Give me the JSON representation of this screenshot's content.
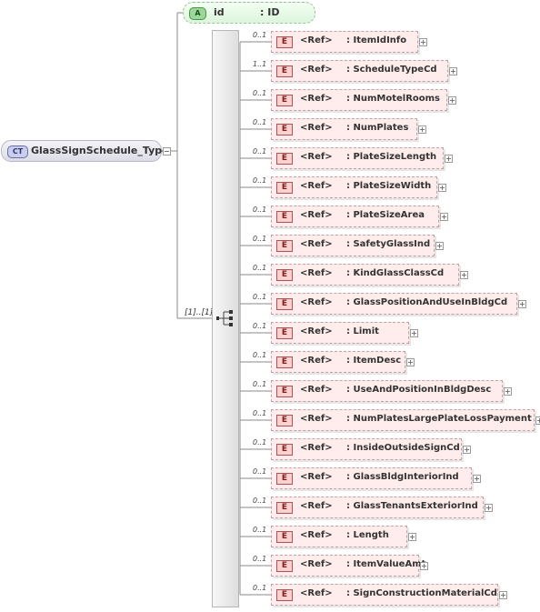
{
  "complex_type": {
    "badge": "CT",
    "name": "GlassSignSchedule_Type"
  },
  "attribute": {
    "badge": "A",
    "name": "id",
    "type": ": ID"
  },
  "sequence": {
    "cardinality": "[1]..[1]"
  },
  "elements": [
    {
      "card": "0..1",
      "badge": "E",
      "ref": "<Ref>",
      "name": ": ItemIdInfo"
    },
    {
      "card": "1..1",
      "badge": "E",
      "ref": "<Ref>",
      "name": ": ScheduleTypeCd"
    },
    {
      "card": "0..1",
      "badge": "E",
      "ref": "<Ref>",
      "name": ": NumMotelRooms"
    },
    {
      "card": "0..1",
      "badge": "E",
      "ref": "<Ref>",
      "name": ": NumPlates"
    },
    {
      "card": "0..1",
      "badge": "E",
      "ref": "<Ref>",
      "name": ": PlateSizeLength"
    },
    {
      "card": "0..1",
      "badge": "E",
      "ref": "<Ref>",
      "name": ": PlateSizeWidth"
    },
    {
      "card": "0..1",
      "badge": "E",
      "ref": "<Ref>",
      "name": ": PlateSizeArea"
    },
    {
      "card": "0..1",
      "badge": "E",
      "ref": "<Ref>",
      "name": ": SafetyGlassInd"
    },
    {
      "card": "0..1",
      "badge": "E",
      "ref": "<Ref>",
      "name": ": KindGlassClassCd"
    },
    {
      "card": "0..1",
      "badge": "E",
      "ref": "<Ref>",
      "name": ": GlassPositionAndUseInBldgCd"
    },
    {
      "card": "0..1",
      "badge": "E",
      "ref": "<Ref>",
      "name": ": Limit"
    },
    {
      "card": "0..1",
      "badge": "E",
      "ref": "<Ref>",
      "name": ": ItemDesc"
    },
    {
      "card": "0..1",
      "badge": "E",
      "ref": "<Ref>",
      "name": ": UseAndPositionInBldgDesc"
    },
    {
      "card": "0..1",
      "badge": "E",
      "ref": "<Ref>",
      "name": ": NumPlatesLargePlateLossPayment"
    },
    {
      "card": "0..1",
      "badge": "E",
      "ref": "<Ref>",
      "name": ": InsideOutsideSignCd"
    },
    {
      "card": "0..1",
      "badge": "E",
      "ref": "<Ref>",
      "name": ": GlassBldgInteriorInd"
    },
    {
      "card": "0..1",
      "badge": "E",
      "ref": "<Ref>",
      "name": ": GlassTenantsExteriorInd"
    },
    {
      "card": "0..1",
      "badge": "E",
      "ref": "<Ref>",
      "name": ": Length"
    },
    {
      "card": "0..1",
      "badge": "E",
      "ref": "<Ref>",
      "name": ": ItemValueAmt"
    },
    {
      "card": "0..1",
      "badge": "E",
      "ref": "<Ref>",
      "name": ": SignConstructionMaterialCd"
    }
  ]
}
